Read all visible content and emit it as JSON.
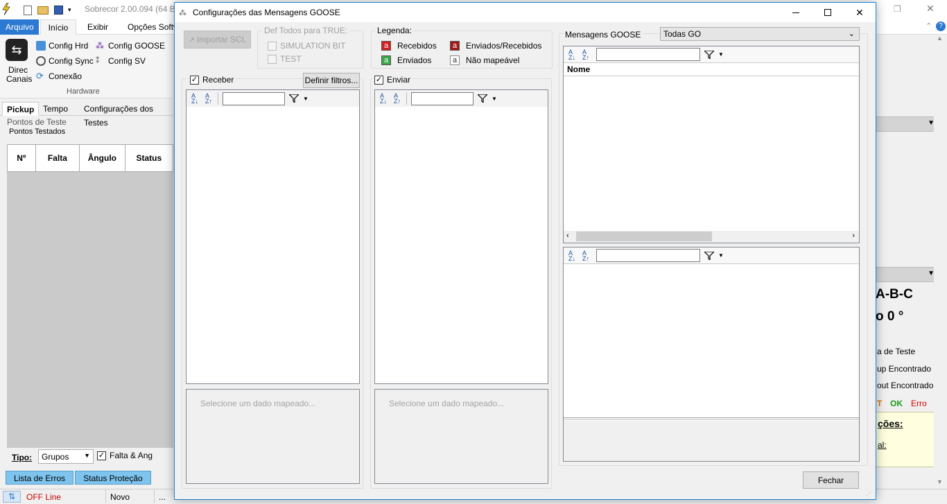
{
  "app": {
    "title": "Sobrecor 2.00.094 (64 Bit",
    "ribbon_tabs": [
      "Arquivo",
      "Início",
      "Exibir",
      "Opções Softw"
    ],
    "ribbon": {
      "direc_label1": "Direc",
      "direc_label2": "Canais",
      "config_hrd": "Config Hrd",
      "config_sync": "Config Sync",
      "conexao": "Conexão",
      "config_goose": "Config GOOSE",
      "config_sv": "Config SV",
      "group_hardware": "Hardware",
      "hrd_tag": "hard"
    },
    "left_tabs": [
      "Pickup",
      "Tempo",
      "Configurações dos Testes"
    ],
    "pontos_de_teste": "Pontos de Teste",
    "pontos_testados": "Pontos Testados",
    "grid_columns": [
      "Nº",
      "Falta",
      "Ângulo",
      "Status"
    ],
    "tipo_label": "Tipo:",
    "tipo_value": "Grupos",
    "falta_ang": "Falta & Ang",
    "bottom_tabs": [
      "Lista de Erros",
      "Status Proteção"
    ],
    "status_offline": "OFF Line",
    "status_novo": "Novo",
    "status_dots": "...",
    "right_partial": {
      "abc": "A-B-C",
      "zero": "o 0 °",
      "de_teste": "a de Teste",
      "pickup": "up Encontrado",
      "out": "out Encontrado",
      "t": "T",
      "ok": "OK",
      "erro": "Erro",
      "coes": "ções:",
      "al": "al:"
    }
  },
  "dialog": {
    "title": "Configurações das Mensagens GOOSE",
    "importar_scl": "Importar SCL",
    "def_todos": "Def Todos para TRUE:",
    "simulation_bit": "SIMULATION BIT",
    "test": "TEST",
    "legenda": "Legenda:",
    "legend": [
      {
        "letter": "a",
        "label": "Recebidos",
        "color": "#d32020"
      },
      {
        "letter": "a",
        "label": "Enviados/Recebidos",
        "color": "#a11a1a"
      },
      {
        "letter": "a",
        "label": "Enviados",
        "color": "#3aa64a"
      },
      {
        "letter": "a",
        "label": "Não mapeável",
        "color": "#ffffff"
      }
    ],
    "receber": "Receber",
    "definir_filtros": "Definir filtros...",
    "enviar": "Enviar",
    "selecione_hint": "Selecione um dado mapeado...",
    "mensagens_goose": "Mensagens GOOSE",
    "todas_go": "Todas GO",
    "nome_col": "Nome",
    "fechar": "Fechar"
  }
}
